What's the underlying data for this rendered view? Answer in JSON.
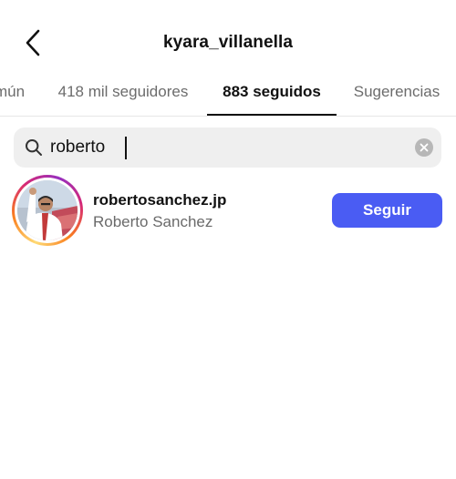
{
  "header": {
    "title": "kyara_villanella",
    "back_icon": "chevron-left-icon"
  },
  "tabs": [
    {
      "label": "mún",
      "active": false
    },
    {
      "label": "418 mil seguidores",
      "active": false
    },
    {
      "label": "883 seguidos",
      "active": true
    },
    {
      "label": "Sugerencias",
      "active": false
    }
  ],
  "search": {
    "value": "roberto",
    "icon": "search-icon",
    "clear_icon": "clear-icon"
  },
  "results": [
    {
      "username": "robertosanchez.jp",
      "full_name": "Roberto Sanchez",
      "button_label": "Seguir",
      "has_story_ring": true
    }
  ],
  "colors": {
    "accent": "#4a5cf3",
    "search_bg": "#efefef",
    "secondary_text": "#6a6a6a"
  }
}
